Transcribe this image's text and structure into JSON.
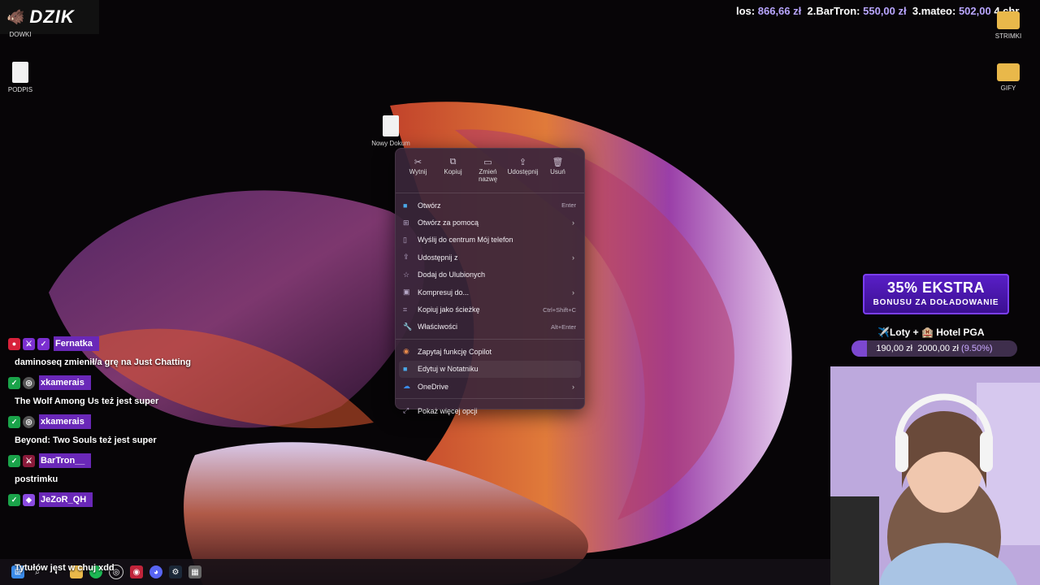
{
  "logo": {
    "text": "DZIK"
  },
  "ticker": [
    {
      "name": "los:",
      "amount": "866,66 zł"
    },
    {
      "name": "2.BarTron:",
      "amount": "550,00 zł"
    },
    {
      "name": "3.mateo:",
      "amount": "502,00"
    },
    {
      "name": "4.chr",
      "amount": ""
    }
  ],
  "desktop": {
    "icons": [
      {
        "label": "DOWKI"
      },
      {
        "label": "PODPIS"
      },
      {
        "label": "Nowy Dokum"
      },
      {
        "label": "STRIMKI"
      },
      {
        "label": "GIFY"
      }
    ]
  },
  "context_menu": {
    "actions": [
      {
        "label": "Wytnij",
        "icon": "scissors-icon"
      },
      {
        "label": "Kopiuj",
        "icon": "copy-icon"
      },
      {
        "label": "Zmień nazwę",
        "icon": "rename-icon"
      },
      {
        "label": "Udostępnij",
        "icon": "share-icon"
      },
      {
        "label": "Usuń",
        "icon": "trash-icon"
      }
    ],
    "items": [
      {
        "label": "Otwórz",
        "shortcut": "Enter"
      },
      {
        "label": "Otwórz za pomocą",
        "submenu": "›"
      },
      {
        "label": "Wyślij do centrum Mój telefon"
      },
      {
        "label": "Udostępnij z",
        "submenu": "›"
      },
      {
        "label": "Dodaj do Ulubionych"
      },
      {
        "label": "Kompresuj do...",
        "submenu": "›"
      },
      {
        "label": "Kopiuj jako ścieżkę",
        "shortcut": "Ctrl+Shift+C"
      },
      {
        "label": "Właściwości",
        "shortcut": "Alt+Enter"
      },
      {
        "label": "Zapytaj funkcję Copilot"
      },
      {
        "label": "Edytuj w Notatniku"
      },
      {
        "label": "OneDrive",
        "submenu": "›"
      },
      {
        "label": "Pokaż więcej opcji"
      }
    ]
  },
  "chat": [
    {
      "user": "Fernatka",
      "name_color": "#7b2fd0",
      "message": "daminoseq zmienił/a grę na Just Chatting"
    },
    {
      "user": "xkamerais",
      "name_color": "#7b2fd0",
      "message": "The Wolf Among Us też jest super"
    },
    {
      "user": "xkamerais",
      "name_color": "#7b2fd0",
      "message": "Beyond: Two Souls też jest super"
    },
    {
      "user": "BarTron__",
      "name_color": "#7b2fd0",
      "message": "postrimku"
    },
    {
      "user": "JeZoR_QH",
      "name_color": "#7b2fd0",
      "message": "Tytułów jest w chuj xdd"
    }
  ],
  "promo": {
    "line1": "35% EKSTRA",
    "line2": "BONUSU ZA DOŁADOWANIE"
  },
  "goal": {
    "title": "✈️Loty + 🏨 Hotel PGA",
    "current": "190,00 zł",
    "target": "2000,00 zł",
    "percent_label": "(9.50%)",
    "fraction": 0.095
  },
  "colors": {
    "accent": "#7c48d0",
    "badge_green": "#1aa34a",
    "menu_bg": "#3a263a"
  }
}
